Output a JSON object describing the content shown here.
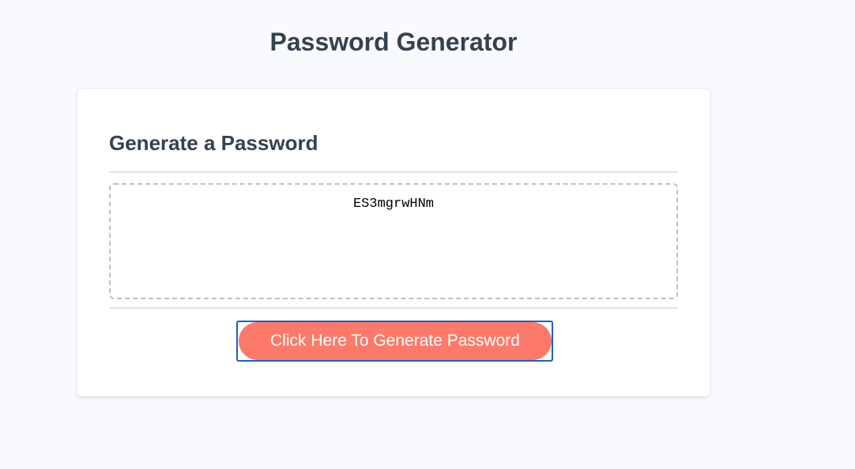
{
  "header": {
    "title": "Password Generator"
  },
  "card": {
    "title": "Generate a Password",
    "password_value": "ES3mgrwHNm",
    "generate_button_label": "Click Here To Generate Password"
  },
  "colors": {
    "background": "#f9fafe",
    "heading_text": "#34424f",
    "button_background": "#fd7969",
    "button_focus_outline": "#1a5fc8"
  }
}
